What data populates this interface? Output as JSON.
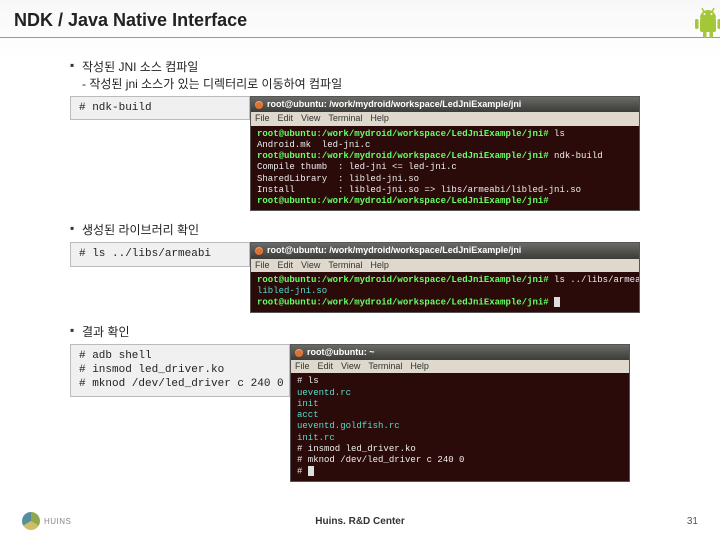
{
  "title": "NDK / Java Native Interface",
  "sections": [
    {
      "bullet": "작성된 JNI 소스 컴파일",
      "sub": "- 작성된 jni 소스가 있는 디렉터리로 이동하여 컴파일",
      "cmd": "# ndk-build",
      "terminal": {
        "title": "root@ubuntu: /work/mydroid/workspace/LedJniExample/jni",
        "menu": [
          "File",
          "Edit",
          "View",
          "Terminal",
          "Help"
        ],
        "lines": [
          {
            "prompt": "root@ubuntu:/work/mydroid/workspace/LedJniExample/jni#",
            "rest": " ls"
          },
          {
            "plain": "Android.mk  led-jni.c"
          },
          {
            "prompt": "root@ubuntu:/work/mydroid/workspace/LedJniExample/jni#",
            "rest": " ndk-build"
          },
          {
            "plain": "Compile thumb  : led-jni <= led-jni.c"
          },
          {
            "plain": "SharedLibrary  : libled-jni.so"
          },
          {
            "plain": "Install        : libled-jni.so => libs/armeabi/libled-jni.so"
          },
          {
            "prompt": "root@ubuntu:/work/mydroid/workspace/LedJniExample/jni#",
            "rest": ""
          }
        ]
      }
    },
    {
      "bullet": "생성된 라이브러리 확인",
      "cmd": "# ls ../libs/armeabi",
      "terminal": {
        "title": "root@ubuntu: /work/mydroid/workspace/LedJniExample/jni",
        "menu": [
          "File",
          "Edit",
          "View",
          "Terminal",
          "Help"
        ],
        "lines": [
          {
            "prompt": "root@ubuntu:/work/mydroid/workspace/LedJniExample/jni#",
            "rest": " ls ../libs/armeabi/"
          },
          {
            "cyan": "libled-jni.so"
          },
          {
            "prompt": "root@ubuntu:/work/mydroid/workspace/LedJniExample/jni#",
            "rest": " ",
            "cursor": true
          }
        ]
      }
    },
    {
      "bullet": "결과 확인",
      "cmd": "# adb shell\n# insmod led_driver.ko\n# mknod /dev/led_driver c 240 0",
      "terminal": {
        "title": "root@ubuntu: ~",
        "menu": [
          "File",
          "Edit",
          "View",
          "Terminal",
          "Help"
        ],
        "lines": [
          {
            "plain": "# ls"
          },
          {
            "cyan": "ueventd.rc"
          },
          {
            "cyan": "init"
          },
          {
            "cyan": "acct"
          },
          {
            "cyan": "ueventd.goldfish.rc"
          },
          {
            "cyan": "init.rc"
          },
          {
            "plain": "# insmod led_driver.ko"
          },
          {
            "plain": "# mknod /dev/led_driver c 240 0"
          },
          {
            "plain": "# ",
            "cursor": true
          }
        ]
      }
    }
  ],
  "footer": {
    "logo_text": "HUINS",
    "center": "Huins. R&D Center",
    "page": "31"
  }
}
